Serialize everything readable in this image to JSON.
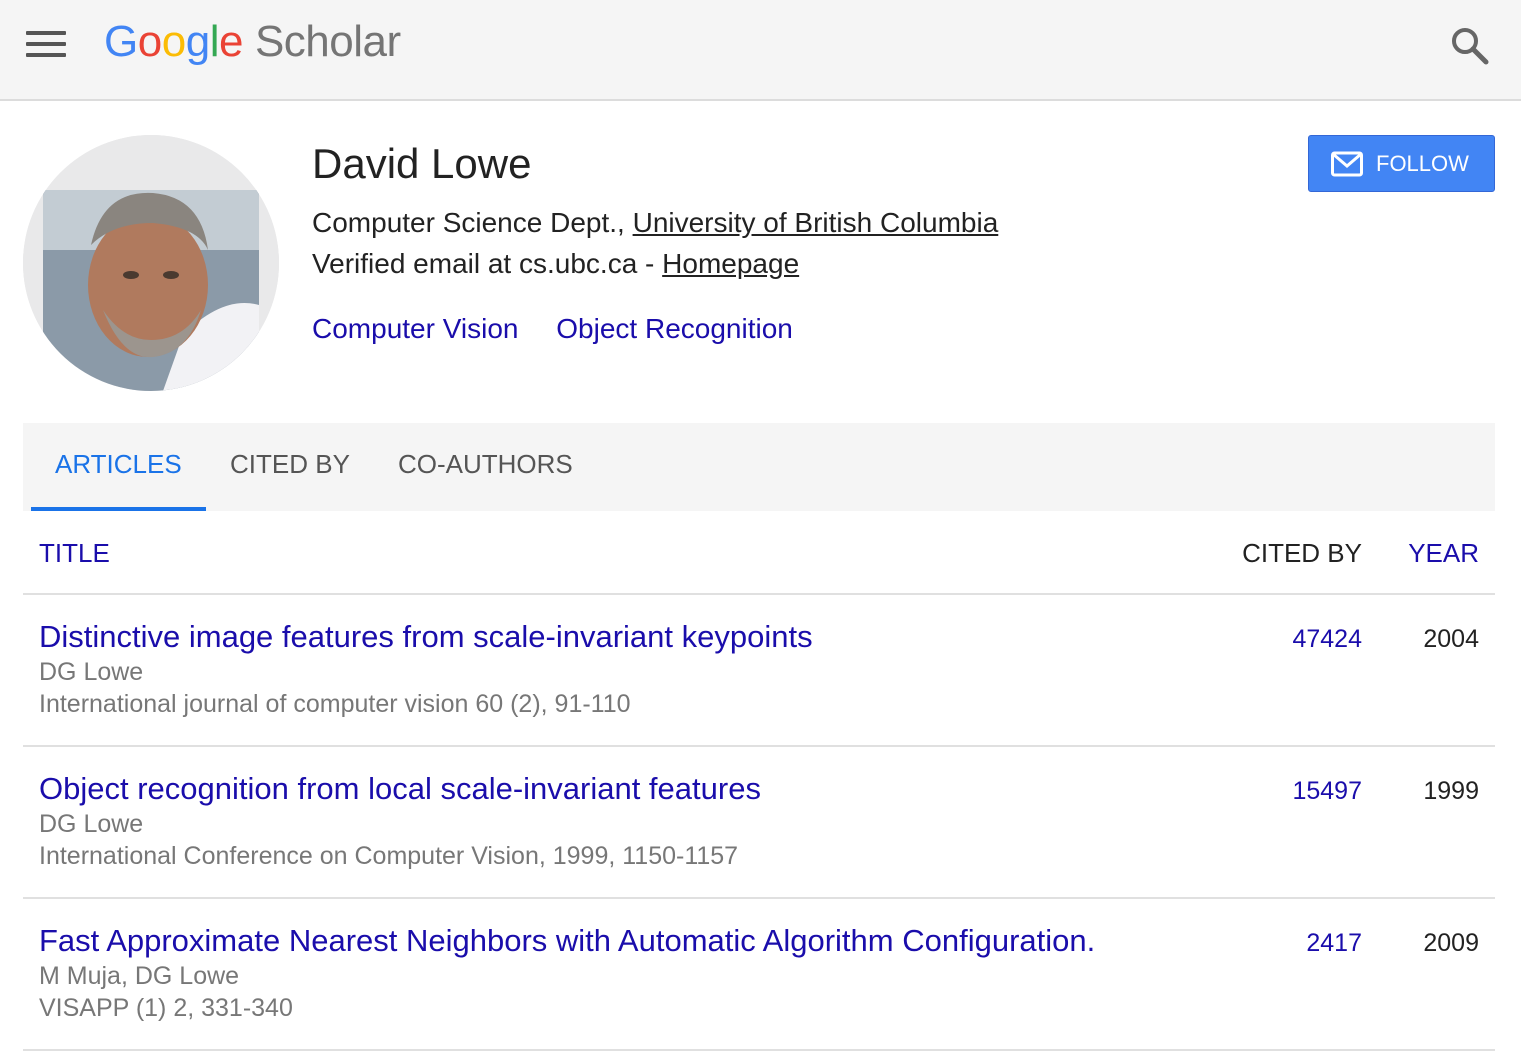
{
  "header": {
    "logo_google": [
      "G",
      "o",
      "o",
      "g",
      "l",
      "e"
    ],
    "logo_scholar": "Scholar"
  },
  "profile": {
    "name": "David Lowe",
    "affiliation_prefix": "Computer Science Dept., ",
    "affiliation_link": "University of British Columbia",
    "email_prefix": "Verified email at cs.ubc.ca - ",
    "homepage_link": "Homepage",
    "interests": [
      "Computer Vision",
      "Object Recognition"
    ],
    "follow_label": "FOLLOW"
  },
  "tabs": [
    {
      "label": "ARTICLES",
      "active": true
    },
    {
      "label": "CITED BY",
      "active": false
    },
    {
      "label": "CO-AUTHORS",
      "active": false
    }
  ],
  "table": {
    "headers": {
      "title": "TITLE",
      "cited_by": "CITED BY",
      "year": "YEAR"
    },
    "rows": [
      {
        "title": "Distinctive image features from scale-invariant keypoints",
        "authors": "DG Lowe",
        "venue": "International journal of computer vision 60 (2), 91-110",
        "cited_by": "47424",
        "year": "2004"
      },
      {
        "title": "Object recognition from local scale-invariant features",
        "authors": "DG Lowe",
        "venue": "International Conference on Computer Vision, 1999, 1150-1157",
        "cited_by": "15497",
        "year": "1999"
      },
      {
        "title": "Fast Approximate Nearest Neighbors with Automatic Algorithm Configuration.",
        "authors": "M Muja, DG Lowe",
        "venue": "VISAPP (1) 2, 331-340",
        "cited_by": "2417",
        "year": "2009"
      }
    ]
  },
  "colors": {
    "link": "#1a0dab",
    "accent": "#1a73e8",
    "follow_button": "#4285f4",
    "google_blue": "#4285f4",
    "google_red": "#ea4335",
    "google_yellow": "#fbbc05",
    "google_green": "#34a853"
  },
  "icons": {
    "menu": "hamburger-menu-icon",
    "search": "search-icon",
    "follow": "envelope-icon",
    "avatar": "profile-photo"
  }
}
